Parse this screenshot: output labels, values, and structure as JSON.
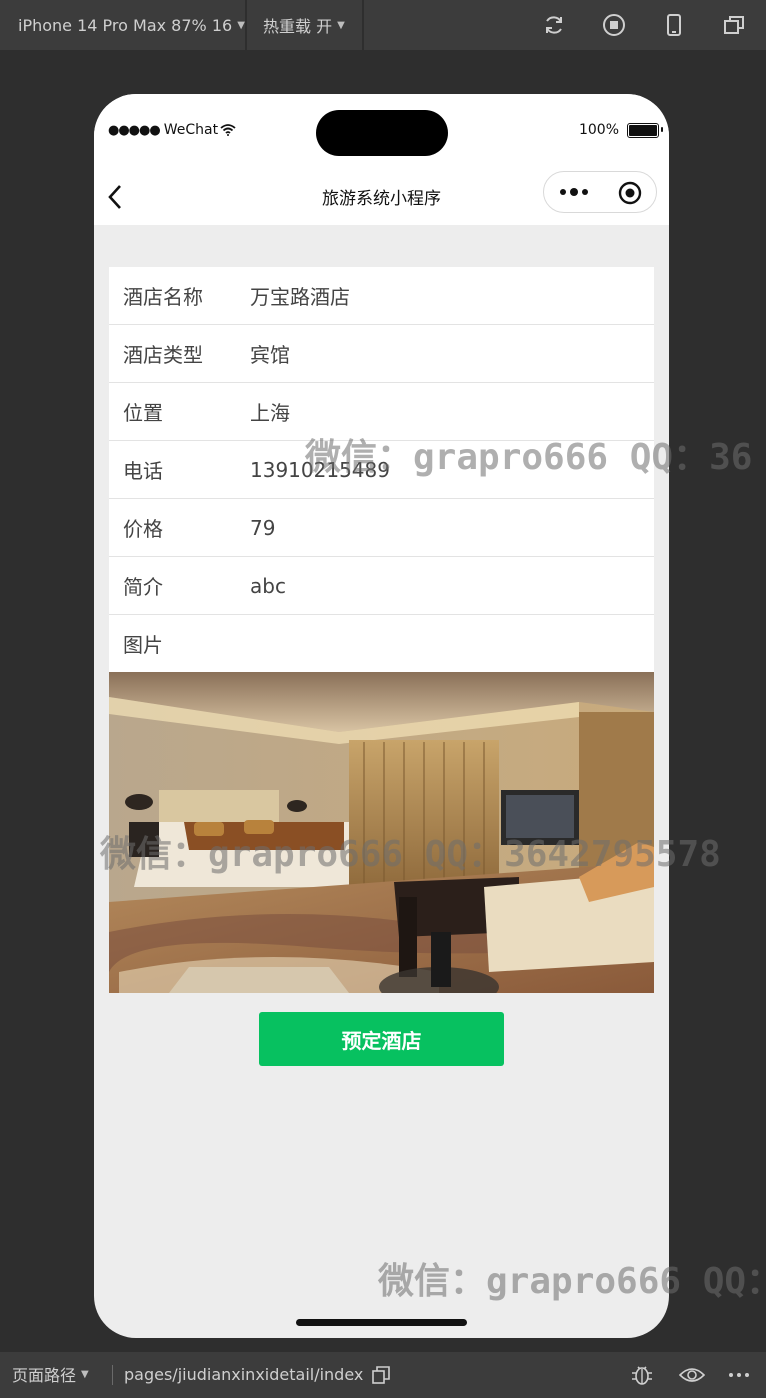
{
  "toolbar": {
    "device": "iPhone 14 Pro Max 87% 16",
    "hot_reload": "热重载 开"
  },
  "status_bar": {
    "carrier": "WeChat",
    "battery": "100%"
  },
  "nav": {
    "title": "旅游系统小程序"
  },
  "hotel": {
    "rows": [
      {
        "label": "酒店名称",
        "value": "万宝路酒店"
      },
      {
        "label": "酒店类型",
        "value": "宾馆"
      },
      {
        "label": "位置",
        "value": "上海"
      },
      {
        "label": "电话",
        "value": "13910215489"
      },
      {
        "label": "价格",
        "value": "79"
      },
      {
        "label": "简介",
        "value": "abc"
      },
      {
        "label": "图片",
        "value": ""
      }
    ],
    "book_label": "预定酒店"
  },
  "watermarks": [
    "微信：grapro666 QQ：36",
    "微信：grapro666 QQ：3642795578",
    "微信：grapro666 QQ："
  ],
  "bottom_bar": {
    "path_label": "页面路径",
    "path": "pages/jiudianxinxidetail/index"
  },
  "colors": {
    "accent": "#07c160",
    "page_bg": "#ededed"
  }
}
